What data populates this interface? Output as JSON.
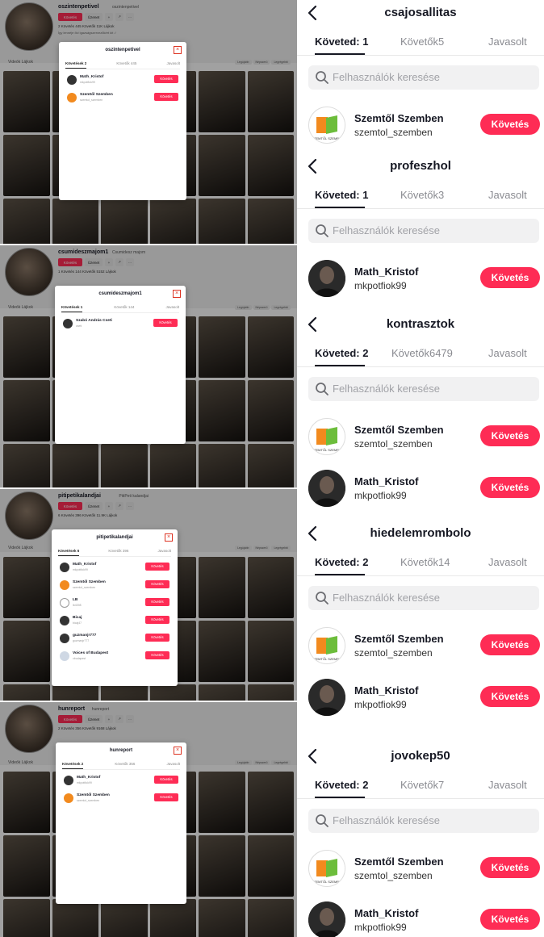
{
  "colors": {
    "accent": "#fe2c55",
    "text": "#161823",
    "muted": "#8a8b91"
  },
  "left_panels": [
    {
      "name": "oszintenpetivel",
      "nickname": "oszintenpetivel",
      "follow": "Követés",
      "message": "Üzenet",
      "stats": "2 Követés  445 Követők  11K Lájkok",
      "bio": "Így lennéje ővi igazságszervezőkért kit :/",
      "tabs": "Videók  Lájkok",
      "sort": [
        "Legújabb",
        "Népszerű",
        "Legrégebbi"
      ],
      "modal": {
        "title": "oszintenpetivel",
        "close": "×",
        "tabs": [
          "Követések 2",
          "Követők 445",
          "Javasolt"
        ],
        "rows": [
          {
            "name": "Math_Kristof",
            "handle": "mkpotfiok99",
            "button": "Követés",
            "av": "mk"
          },
          {
            "name": "Szemtől Szemben",
            "handle": "szemtol_szemben",
            "button": "Követés",
            "av": "sz"
          }
        ]
      }
    },
    {
      "name": "csumideszmajom1",
      "nickname": "Csumidesz majom",
      "follow": "Követés",
      "message": "Üzenet",
      "stats": "1 Követés  144 Követők  5152 Lájkok",
      "bio": "",
      "tabs": "Videók  Lájkok",
      "sort": [
        "Legújabb",
        "Népszerű",
        "Legrégebbi"
      ],
      "modal": {
        "title": "csumideszmajom1",
        "close": "×",
        "tabs": [
          "Követések 1",
          "Követők 144",
          "Javasolt"
        ],
        "rows": [
          {
            "name": "Szabó András Cseti",
            "handle": "cseti",
            "button": "Követés",
            "av": "mk"
          }
        ]
      }
    },
    {
      "name": "pitipetikalandjai",
      "nickname": "PitiPeti kalandjai",
      "follow": "Követés",
      "message": "Üzenet",
      "stats": "6 Követés  396 Követők  11.9K Lájkok",
      "bio": "",
      "tabs": "Videók  Lájkok",
      "sort": [
        "Legújabb",
        "Népszerű",
        "Legrégebbi"
      ],
      "modal": {
        "title": "pitipetikalandjai",
        "close": "×",
        "tabs": [
          "Követések 6",
          "Követők 396",
          "Javasolt"
        ],
        "rows": [
          {
            "name": "Math_Kristof",
            "handle": "mkpotfiok99",
            "button": "Követés",
            "av": "mk"
          },
          {
            "name": "Szemtől Szemben",
            "handle": "szemtol_szemben",
            "button": "Követés",
            "av": "sz"
          },
          {
            "name": "LB",
            "handle": "lb4398",
            "button": "Követés",
            "av": "lb"
          },
          {
            "name": "Bicaj",
            "handle": "bicaj47",
            "button": "Követés",
            "av": "mk"
          },
          {
            "name": "guzmanjr777",
            "handle": "guzmanjr777",
            "button": "Követés",
            "av": "mk"
          },
          {
            "name": "Voices of Budapest",
            "handle": "vbudapest",
            "button": "Követés",
            "av": "vb"
          }
        ]
      }
    },
    {
      "name": "hunreport",
      "nickname": "hunreport",
      "follow": "Követés",
      "message": "Üzenet",
      "stats": "2 Követés  356 Követők  9168 Lájkok",
      "bio": "",
      "tabs": "Videók  Lájkok",
      "sort": [
        "Legújabb",
        "Népszerű",
        "Legrégebbi"
      ],
      "modal": {
        "title": "hunreport",
        "close": "×",
        "tabs": [
          "Követések 2",
          "Követők 356",
          "Javasolt"
        ],
        "rows": [
          {
            "name": "Math_Kristof",
            "handle": "mkpotfiok99",
            "button": "Követés",
            "av": "mk"
          },
          {
            "name": "Szemtől Szemben",
            "handle": "szemtol_szemben",
            "button": "Követés",
            "av": "sz"
          }
        ]
      }
    }
  ],
  "right_sections": [
    {
      "title": "csajosallitas",
      "tabs": [
        "Követed: 1",
        "Követők5",
        "Javasolt"
      ],
      "search": "Felhasználók keresése",
      "users": [
        {
          "name": "Szemtől Szemben",
          "handle": "szemtol_szemben",
          "button": "Követés",
          "av": "sz"
        }
      ]
    },
    {
      "title": "profeszhol",
      "tabs": [
        "Követed: 1",
        "Követők3",
        "Javasolt"
      ],
      "search": "Felhasználók keresése",
      "users": [
        {
          "name": "Math_Kristof",
          "handle": "mkpotfiok99",
          "button": "Követés",
          "av": "mk"
        }
      ]
    },
    {
      "title": "kontrasztok",
      "tabs": [
        "Követed: 2",
        "Követők6479",
        "Javasolt"
      ],
      "search": "Felhasználók keresése",
      "users": [
        {
          "name": "Szemtől Szemben",
          "handle": "szemtol_szemben",
          "button": "Követés",
          "av": "sz"
        },
        {
          "name": "Math_Kristof",
          "handle": "mkpotfiok99",
          "button": "Követés",
          "av": "mk"
        }
      ]
    },
    {
      "title": "hiedelemrombolo",
      "tabs": [
        "Követed: 2",
        "Követők14",
        "Javasolt"
      ],
      "search": "Felhasználók keresése",
      "users": [
        {
          "name": "Szemtől Szemben",
          "handle": "szemtol_szemben",
          "button": "Követés",
          "av": "sz"
        },
        {
          "name": "Math_Kristof",
          "handle": "mkpotfiok99",
          "button": "Követés",
          "av": "mk"
        }
      ]
    },
    {
      "title": "jovokep50",
      "tabs": [
        "Követed: 2",
        "Követők7",
        "Javasolt"
      ],
      "search": "Felhasználók keresése",
      "users": [
        {
          "name": "Szemtől Szemben",
          "handle": "szemtol_szemben",
          "button": "Követés",
          "av": "sz"
        },
        {
          "name": "Math_Kristof",
          "handle": "mkpotfiok99",
          "button": "Követés",
          "av": "mk"
        }
      ]
    }
  ]
}
